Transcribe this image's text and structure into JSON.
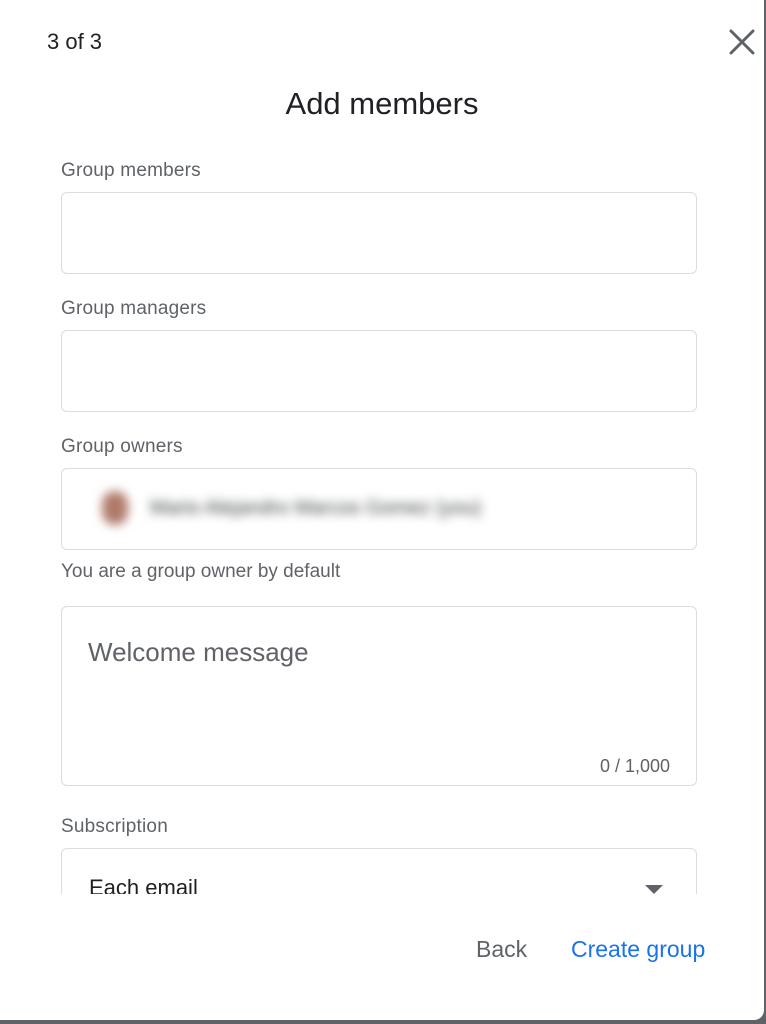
{
  "dialog": {
    "step": "3 of 3",
    "title": "Add members"
  },
  "fields": {
    "members_label": "Group members",
    "managers_label": "Group managers",
    "owners_label": "Group owners",
    "owner_name": "Mario Alejandro Marcos Gomez (you)",
    "owner_hint": "You are a group owner by default",
    "welcome_placeholder": "Welcome message",
    "welcome_counter": "0 / 1,000",
    "subscription_label": "Subscription",
    "subscription_value": "Each email"
  },
  "footer": {
    "back_label": "Back",
    "create_label": "Create group"
  },
  "colors": {
    "accent": "#1a73e8",
    "text_primary": "#202124",
    "text_secondary": "#5f6368",
    "border": "#dadce0"
  }
}
